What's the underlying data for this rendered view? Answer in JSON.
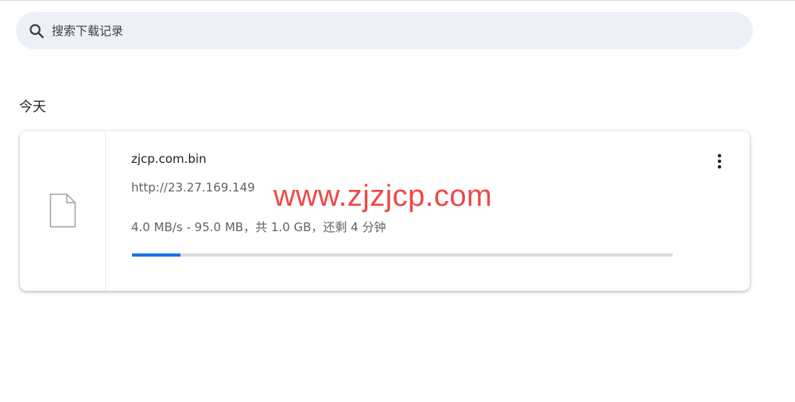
{
  "search": {
    "placeholder": "搜索下载记录",
    "value": ""
  },
  "section": {
    "title": "今天"
  },
  "download": {
    "file_name": "zjcp.com.bin",
    "url": "http://23.27.169.149",
    "status": "4.0 MB/s - 95.0 MB，共 1.0 GB，还剩 4 分钟",
    "progress_percent": 9
  },
  "watermark": {
    "text": "www.zjzjcp.com"
  },
  "colors": {
    "accent": "#1a73e8",
    "track": "#dadce0",
    "search_bg": "#eef0f7",
    "watermark": "#f04747"
  },
  "icons": {
    "search": "search-icon",
    "file": "file-icon",
    "more": "more-vert-icon"
  }
}
